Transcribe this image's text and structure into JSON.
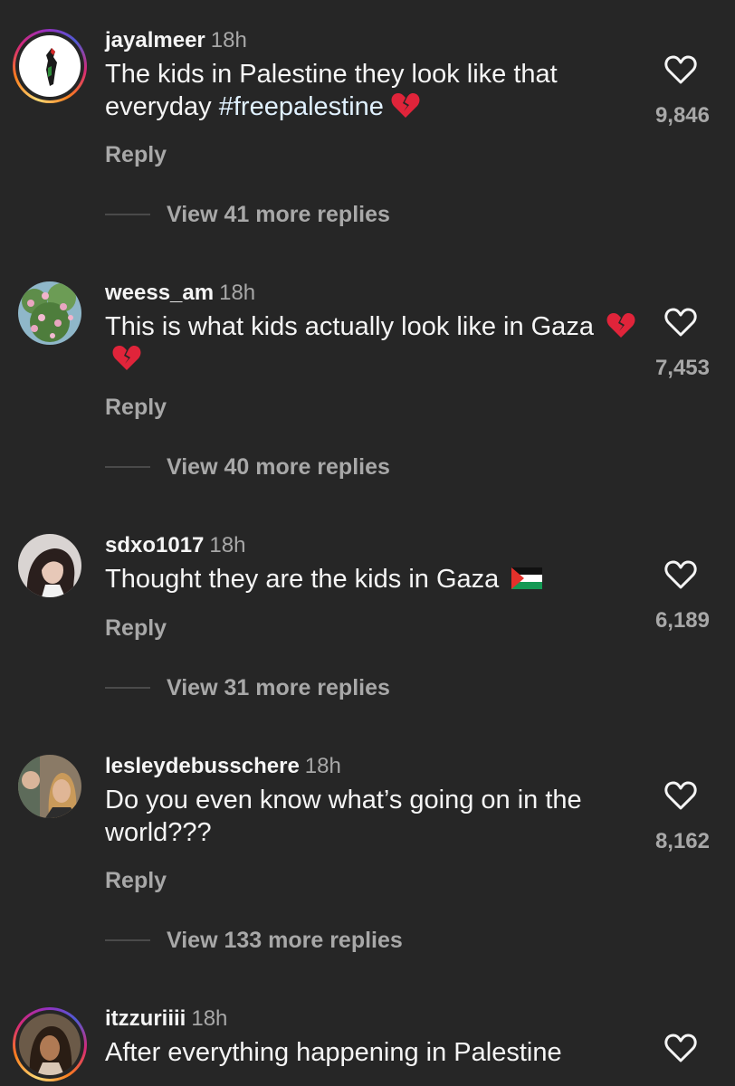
{
  "reply_label": "Reply",
  "comments": [
    {
      "username": "jayalmeer",
      "time": "18h",
      "text": "The kids in Palestine they look like that everyday ",
      "hashtag": "#freepalestine",
      "emojis": [
        "broken-heart"
      ],
      "likes": "9,846",
      "view_replies": "View 41 more replies",
      "avatar_ring": true
    },
    {
      "username": "weess_am",
      "time": "18h",
      "text": "This is what kids actually look like in Gaza",
      "emojis": [
        "broken-heart",
        "broken-heart"
      ],
      "likes": "7,453",
      "view_replies": "View 40 more replies",
      "avatar_ring": false
    },
    {
      "username": "sdxo1017",
      "time": "18h",
      "text": "Thought they are the kids in Gaza",
      "emojis": [
        "palestine-flag"
      ],
      "likes": "6,189",
      "view_replies": "View 31 more replies",
      "avatar_ring": false
    },
    {
      "username": "lesleydebusschere",
      "time": "18h",
      "text": "Do you even know what’s going on in the world???",
      "emojis": [],
      "likes": "8,162",
      "view_replies": "View 133 more replies",
      "avatar_ring": false
    },
    {
      "username": "itzzuriiii",
      "time": "18h",
      "text": "After everything happening in Palestine",
      "emojis": [],
      "likes": "",
      "view_replies": "",
      "avatar_ring": true
    }
  ],
  "colors": {
    "background": "#262626",
    "primary_text": "#f5f5f5",
    "secondary_text": "#a8a8a8",
    "broken_heart": "#e0243a"
  }
}
